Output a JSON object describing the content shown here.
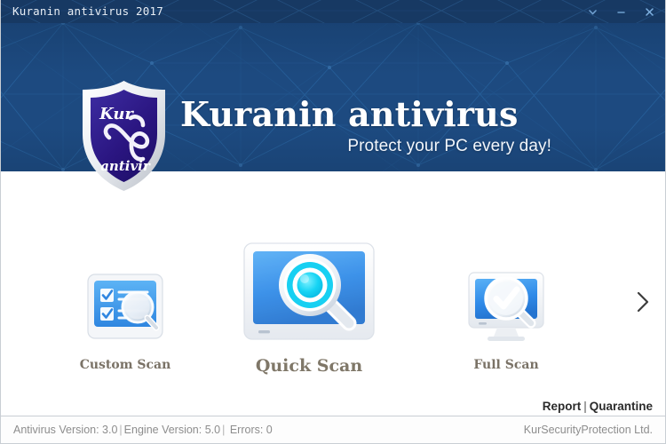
{
  "window": {
    "title": "Kuranin antivirus 2017",
    "controls": [
      {
        "name": "chevron-down-icon",
        "label": "⌄"
      },
      {
        "name": "minimize-icon",
        "label": "–"
      },
      {
        "name": "close-icon",
        "label": "✕"
      }
    ]
  },
  "banner": {
    "logo": {
      "top_text": "Kur",
      "bottom_text": "antivir"
    },
    "title": "Kuranin antivirus",
    "tagline": "Protect your PC every day!"
  },
  "scans": [
    {
      "id": "custom",
      "label": "Custom Scan",
      "icon": "checklist-magnifier-icon"
    },
    {
      "id": "quick",
      "label": "Quick Scan",
      "icon": "monitor-target-magnifier-icon"
    },
    {
      "id": "full",
      "label": "Full Scan",
      "icon": "monitor-check-magnifier-icon"
    }
  ],
  "next_arrow": {
    "name": "chevron-right-icon",
    "label": "›"
  },
  "links": {
    "report": "Report",
    "separator": "|",
    "quarantine": "Quarantine"
  },
  "status": {
    "antivirus_version": "Antivirus Version: 3.0",
    "sep1": "|",
    "engine_version": "Engine Version: 5.0",
    "sep2": "|",
    "errors": "Errors: 0",
    "company": "KurSecurityProtection Ltd."
  },
  "colors": {
    "titlebar": "#173963",
    "banner": "#1d4a80",
    "accent_cyan": "#17d6f5",
    "icon_blue": "#3b97e8",
    "label": "#7a7266"
  }
}
